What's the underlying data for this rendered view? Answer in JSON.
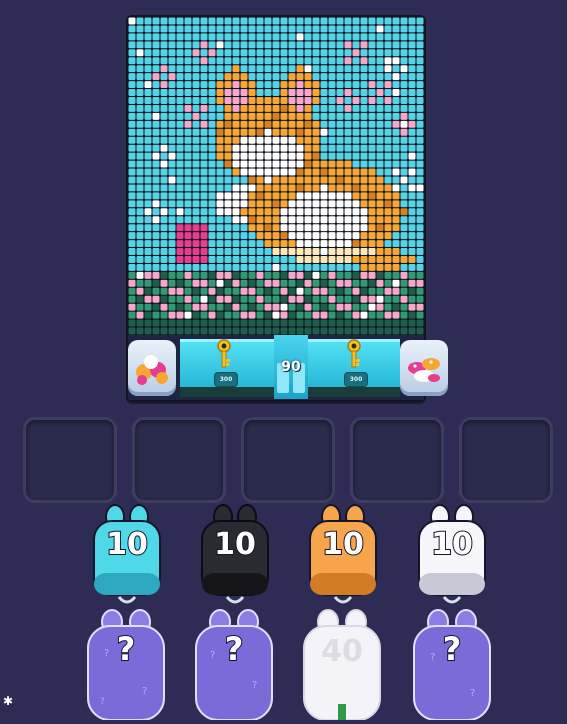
{
  "board": {
    "left_bin_icon": "candy-pile-icon",
    "right_bin_icon": "mushroom-pile-icon",
    "left_chip": "300",
    "right_chip": "300",
    "gate_count": "90",
    "palette": {
      "sky": "#55d4e8",
      "white": "#ffffff",
      "orange": "#f6a733",
      "cream": "#ffe9b8",
      "pink": "#f7a7c9",
      "magenta": "#e53d8f",
      "dark": "#1a1e2e",
      "grass": "#2f9a74",
      "darkgreen": "#1d5e4a",
      "shadow": "#c7cde0",
      "deeporange": "#d9801f"
    }
  },
  "slots": [
    {
      "state": "empty"
    },
    {
      "state": "empty"
    },
    {
      "state": "empty"
    },
    {
      "state": "empty"
    },
    {
      "state": "empty"
    }
  ],
  "shooters": [
    {
      "color": "#4fd8e8",
      "dark": "#2ea9c2",
      "count": "10"
    },
    {
      "color": "#2a2a33",
      "dark": "#151519",
      "count": "10"
    },
    {
      "color": "#f6a54d",
      "dark": "#d27d26",
      "count": "10"
    },
    {
      "color": "#f6f6fb",
      "dark": "#c9c9d6",
      "count": "10"
    }
  ],
  "queued": [
    {
      "label": "?",
      "kind": "hidden"
    },
    {
      "label": "?",
      "kind": "hidden"
    },
    {
      "label": "40",
      "kind": "white"
    },
    {
      "label": "?",
      "kind": "hidden"
    }
  ],
  "settings_icon": "gear-icon"
}
